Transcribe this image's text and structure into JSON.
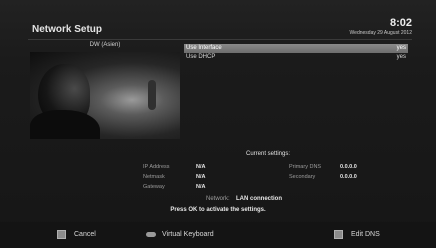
{
  "header": {
    "title": "Network Setup",
    "time": "8:02",
    "date": "Wednesday 29 August 2012"
  },
  "preview": {
    "channel": "DW (Asien)"
  },
  "menu": [
    {
      "label": "Use Interface",
      "value": "yes",
      "selected": true
    },
    {
      "label": "Use DHCP",
      "value": "yes",
      "selected": false
    }
  ],
  "settings": {
    "title": "Current settings:",
    "ip_label": "IP Address",
    "ip_value": "N/A",
    "netmask_label": "Netmask",
    "netmask_value": "N/A",
    "gateway_label": "Gateway",
    "gateway_value": "N/A",
    "dns1_label": "Primary DNS",
    "dns1_value": "0.0.0.0",
    "dns2_label": "Secondary",
    "dns2_value": "0.0.0.0",
    "network_label": "Network:",
    "network_value": "LAN connection",
    "hint": "Press OK to activate the settings."
  },
  "footer": {
    "cancel": "Cancel",
    "keyboard": "Virtual Keyboard",
    "edit_dns": "Edit DNS"
  },
  "colors": {
    "red_key": "#8c8c8c",
    "selection": "#7a7a7a"
  }
}
